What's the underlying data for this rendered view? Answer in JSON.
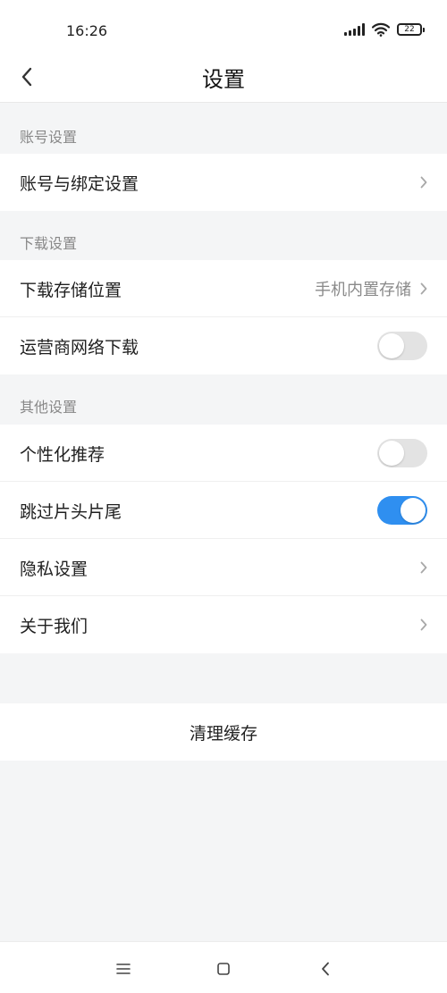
{
  "status_bar": {
    "time": "16:26",
    "battery_level": "22"
  },
  "header": {
    "title": "设置",
    "back_icon": "chevron-left-icon"
  },
  "sections": {
    "account": {
      "header": "账号设置",
      "items": [
        {
          "label": "账号与绑定设置",
          "type": "link"
        }
      ]
    },
    "download": {
      "header": "下载设置",
      "items": [
        {
          "label": "下载存储位置",
          "value": "手机内置存储",
          "type": "link"
        },
        {
          "label": "运营商网络下载",
          "type": "toggle",
          "on": false
        }
      ]
    },
    "other": {
      "header": "其他设置",
      "items": [
        {
          "label": "个性化推荐",
          "type": "toggle",
          "on": false
        },
        {
          "label": "跳过片头片尾",
          "type": "toggle",
          "on": true
        },
        {
          "label": "隐私设置",
          "type": "link"
        },
        {
          "label": "关于我们",
          "type": "link"
        }
      ]
    }
  },
  "actions": {
    "clear_cache_label": "清理缓存"
  },
  "colors": {
    "accent": "#2f8ff0",
    "background": "#f4f5f6",
    "toggle_off": "#e3e3e3"
  },
  "system_nav": {
    "menu_icon": "menu-icon",
    "home_icon": "home-icon",
    "back_icon": "back-icon"
  }
}
